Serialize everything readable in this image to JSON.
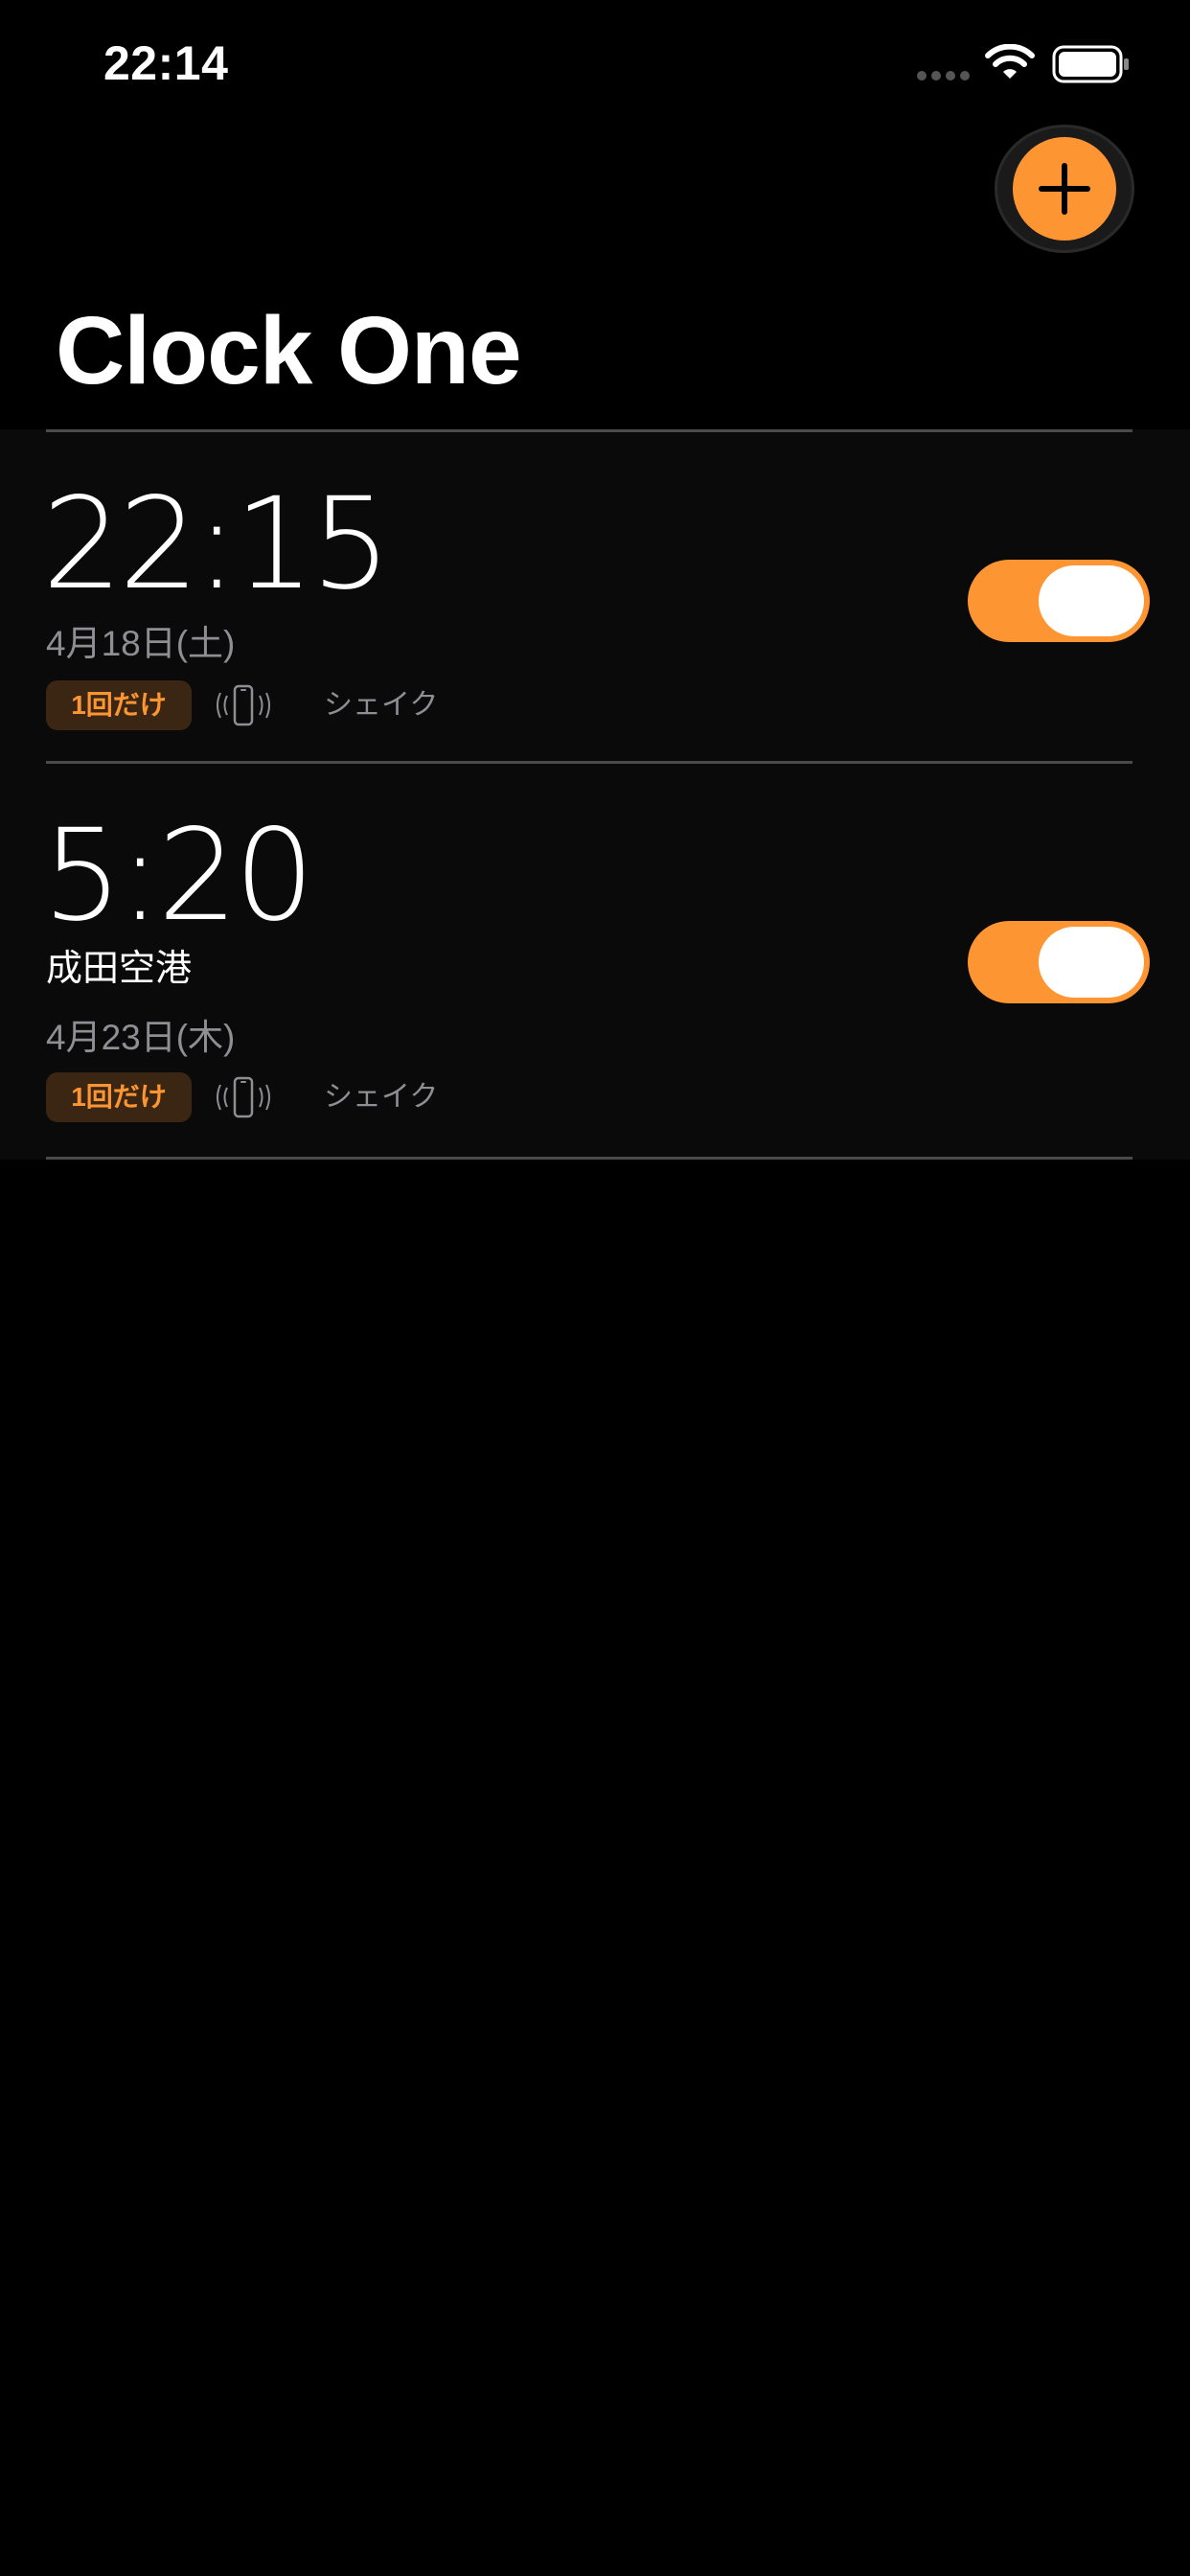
{
  "status_bar": {
    "time": "22:14",
    "signal_icon": "signal-dots-icon",
    "wifi_icon": "wifi-icon",
    "battery_icon": "battery-icon"
  },
  "header": {
    "add_icon": "plus-icon",
    "title": "Clock One"
  },
  "colors": {
    "accent": "#fe9533",
    "background": "#000000",
    "secondary_text": "#8e8e93",
    "badge_background": "#3a2613"
  },
  "alarms": [
    {
      "time": "22:15",
      "label": "",
      "date": "4月18日(土)",
      "repeat_badge": "1回だけ",
      "vibrate_icon": "vibrate-phone-icon",
      "stop_method": "シェイク",
      "enabled": true
    },
    {
      "time": "5:20",
      "label": "成田空港",
      "date": "4月23日(木)",
      "repeat_badge": "1回だけ",
      "vibrate_icon": "vibrate-phone-icon",
      "stop_method": "シェイク",
      "enabled": true
    }
  ]
}
